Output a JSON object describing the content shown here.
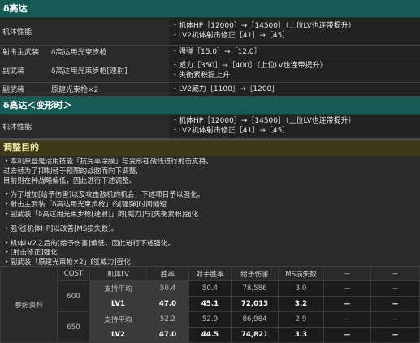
{
  "sec1": {
    "title": "δ高达",
    "rows": [
      {
        "label": "机体性能",
        "sub": "",
        "lines": [
          "・机体HP［12000］→［14500］（上位LV也连带提升）",
          "・LV2机体射击修正［41］→［45］"
        ]
      },
      {
        "label": "射击主武装",
        "sub": "δ高达用光束步枪",
        "lines": [
          "・强弹［15.0］→［12.0］"
        ]
      },
      {
        "label": "副武装",
        "sub": "δ高达用光束步枪[速射]",
        "lines": [
          "・威力［350］→［400］（上位LV也连带提升）",
          "・失衡累积提上升"
        ]
      },
      {
        "label": "副武装",
        "sub": "原建光束枪×2",
        "lines": [
          "・LV2威力［1100］→［1200］"
        ]
      }
    ]
  },
  "sec2": {
    "title": "δ高达＜变形时＞",
    "rows": [
      {
        "label": "机体性能",
        "lines": [
          "・机体HP［12000］→［14500］（上位LV也连带提升）",
          "・LV2机体射击修正［41］→［45］"
        ]
      }
    ]
  },
  "adjust": {
    "title": "调整目的",
    "lines": [
      "・本机原登是活用技能「抗完率涂膜」与变形在战线进行射击支持。",
      "过去替为了抑制替于预限的战脑而向下调整,",
      "目前则在种战略偏低，因此进行下述调整。",
      "",
      "・为了增加[给予伤害]以及攻击敌机的机会，下述项目予以强化。",
      "・射击主武装「δ高达用光束步枪」的[强弹]时间缩短",
      "・副武装「δ高达用光束步枪[速射]」的[威力]与[失衡累积]强化",
      "",
      "・强化[机体HP]以改善[MS损失数]。",
      "",
      "・机体LV2之后的[给予伤害]偏低，因此进行下述强化。",
      "・[射击修正]强化",
      "・副武装「原建光束枪×2」的[威力]强化"
    ]
  },
  "ref": {
    "label": "参照资料",
    "headers": [
      "COST",
      "机体LV",
      "胜率",
      "对手胜率",
      "给予伤害",
      "MS损失数",
      "－",
      "－"
    ],
    "groups": [
      {
        "cost": "600",
        "rows": [
          {
            "lv": "支持平均",
            "win": "50.4",
            "opp": "50.4",
            "dmg": "78,586",
            "loss": "3.0",
            "a": "－",
            "b": "－",
            "avg": true
          },
          {
            "lv": "LV1",
            "win": "47.0",
            "opp": "45.1",
            "dmg": "72,013",
            "loss": "3.2",
            "a": "－",
            "b": "－",
            "avg": false
          }
        ]
      },
      {
        "cost": "650",
        "rows": [
          {
            "lv": "支持平均",
            "win": "52.2",
            "opp": "52.9",
            "dmg": "86,984",
            "loss": "2.9",
            "a": "－",
            "b": "－",
            "avg": true
          },
          {
            "lv": "LV2",
            "win": "47.0",
            "opp": "44.5",
            "dmg": "74,821",
            "loss": "3.3",
            "a": "－",
            "b": "－",
            "avg": false
          }
        ]
      }
    ]
  }
}
